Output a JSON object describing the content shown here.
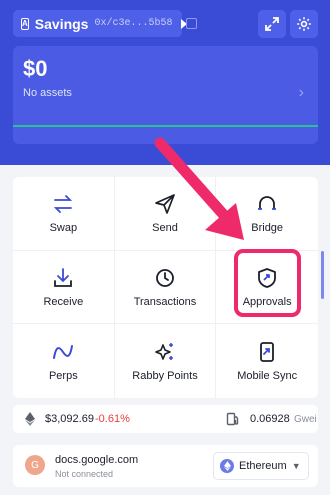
{
  "header": {
    "account_name": "Savings",
    "account_address": "0x/c3e...5b58",
    "account_badge": "A"
  },
  "balance": {
    "value": "$0",
    "subtitle": "No assets"
  },
  "actions": [
    {
      "label": "Swap",
      "icon": "swap-arrows-icon"
    },
    {
      "label": "Send",
      "icon": "paper-plane-icon"
    },
    {
      "label": "Bridge",
      "icon": "bridge-icon"
    },
    {
      "label": "Receive",
      "icon": "download-icon"
    },
    {
      "label": "Transactions",
      "icon": "clock-icon"
    },
    {
      "label": "Approvals",
      "icon": "shield-icon"
    },
    {
      "label": "Perps",
      "icon": "perps-icon"
    },
    {
      "label": "Rabby Points",
      "icon": "sparkle-icon"
    },
    {
      "label": "Mobile Sync",
      "icon": "mobile-sync-icon"
    }
  ],
  "prices": {
    "eth_price": "$3,092.69",
    "eth_change": "-0.61%",
    "gas_value": "0.06928",
    "gas_unit": "Gwei"
  },
  "site": {
    "avatar_letter": "G",
    "name": "docs.google.com",
    "status": "Not connected",
    "chain": "Ethereum"
  },
  "colors": {
    "header_bg": "#3a4bd6",
    "accent_green": "#27c193",
    "highlight": "#ee2a6a",
    "negative": "#ea3c3c"
  }
}
